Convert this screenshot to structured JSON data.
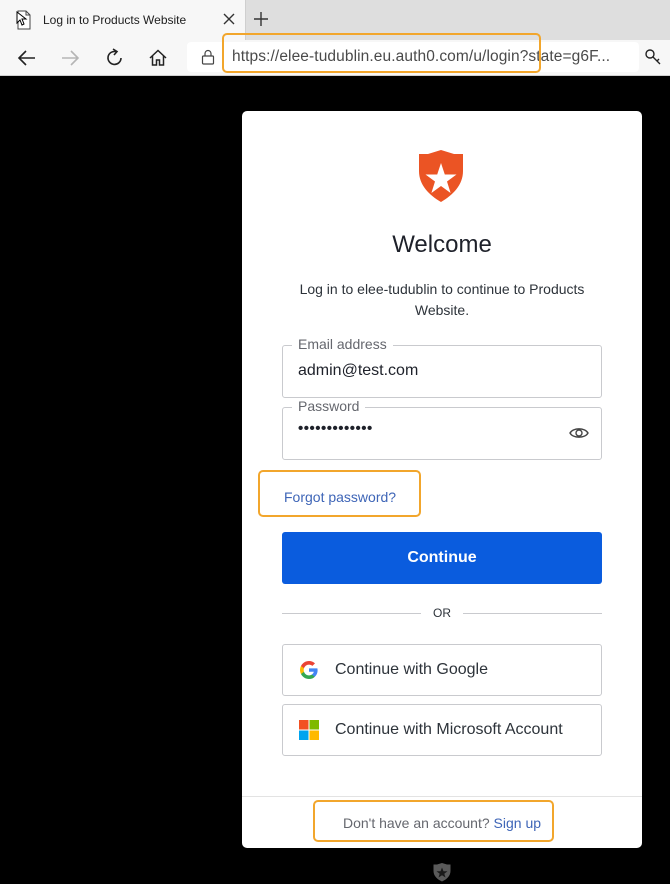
{
  "browser": {
    "tab_title": "Log in to Products Website",
    "url": "https://elee-tudublin.eu.auth0.com/u/login?state=g6F..."
  },
  "login": {
    "heading": "Welcome",
    "subtitle": "Log in to elee-tudublin to continue to Products Website.",
    "email_label": "Email address",
    "email_value": "admin@test.com",
    "password_label": "Password",
    "password_mask": "•••••••••••••",
    "forgot_password": "Forgot password?",
    "continue_label": "Continue",
    "or_label": "OR",
    "google_label": "Continue with Google",
    "microsoft_label": "Continue with Microsoft Account",
    "no_account_text": "Don't have an account?",
    "signup_label": "Sign up"
  },
  "colors": {
    "primary_button": "#0a5cde",
    "link": "#3e65b7",
    "highlight_box": "#f2a62c",
    "logo": "#eb5424"
  }
}
